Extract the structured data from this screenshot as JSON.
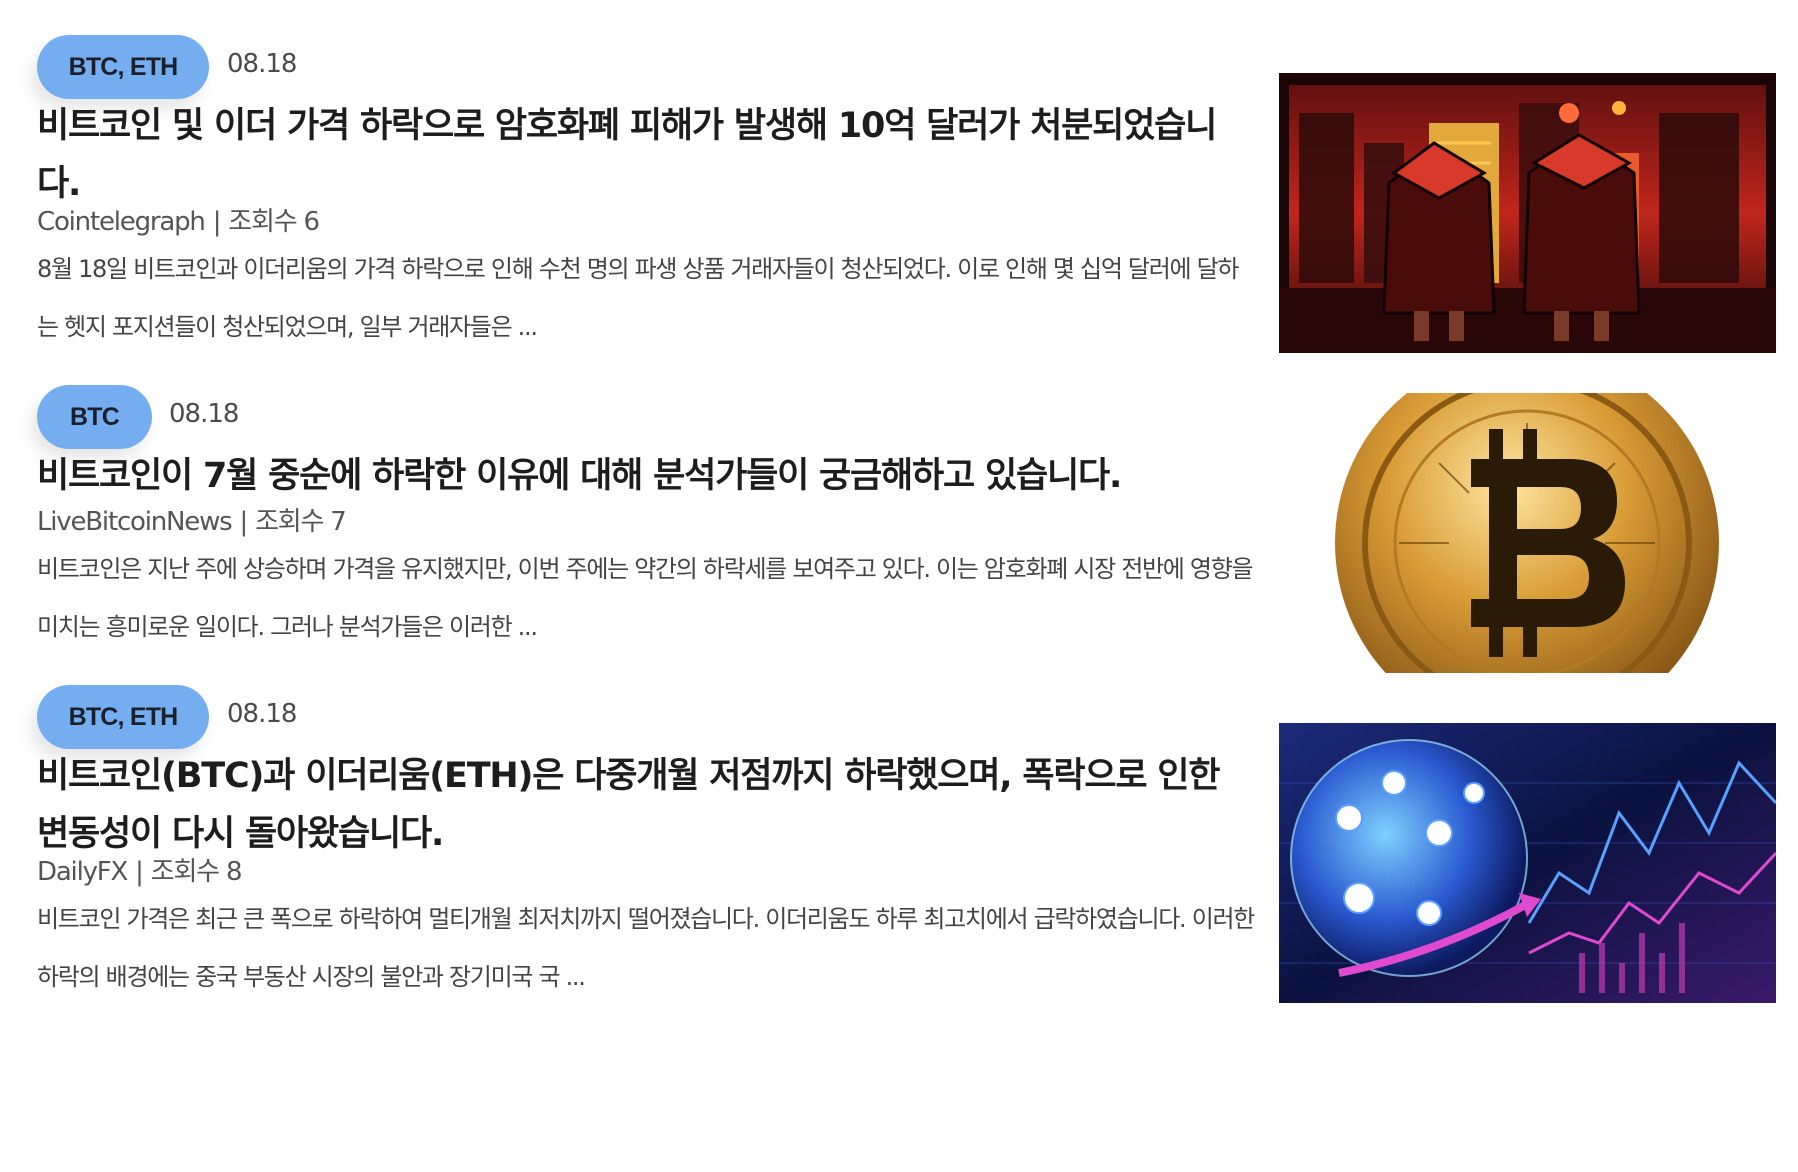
{
  "articles": [
    {
      "tag": "BTC, ETH",
      "date": "08.18",
      "title": "비트코인 및 이더 가격 하락으로 암호화폐 피해가 발생해 10억 달러가 처분되었습니다.",
      "source": "Cointelegraph",
      "views": "조회수 6",
      "summary": "8월 18일 비트코인과 이더리움의 가격 하락으로 인해 수천 명의 파생 상품 거래자들이 청산되었다. 이로 인해 몇 십억 달러에 달하는 헷지 포지션들이 청산되었으며, 일부 거래자들은 ...",
      "thumbnail": "crypto-bears-red-city-illustration"
    },
    {
      "tag": "BTC",
      "date": "08.18",
      "title": "비트코인이 7월 중순에 하락한 이유에 대해 분석가들이 궁금해하고 있습니다.",
      "source": "LiveBitcoinNews",
      "views": "조회수 7",
      "summary": "비트코인은 지난 주에 상승하며 가격을 유지했지만, 이번 주에는 약간의 하락세를 보여주고 있다. 이는 암호화폐 시장 전반에 영향을 미치는 흥미로운 일이다. 그러나 분석가들은 이러한 ...",
      "thumbnail": "gold-bitcoin-coin"
    },
    {
      "tag": "BTC, ETH",
      "date": "08.18",
      "title": "비트코인(BTC)과 이더리움(ETH)은 다중개월 저점까지 하락했으며, 폭락으로 인한 변동성이 다시 돌아왔습니다.",
      "source": "DailyFX",
      "views": "조회수 8",
      "summary": "비트코인 가격은 최근 큰 폭으로 하락하여 멀티개월 최저치까지 떨어졌습니다. 이더리움도 하루 최고치에서 급락하였습니다. 이러한 하락의 배경에는 중국 부동산 시장의 불안과 장기미국 국 ...",
      "thumbnail": "crypto-globe-chart"
    }
  ],
  "colors": {
    "tag_background": "#75aef0",
    "title_text": "#1d1d1d",
    "body_text": "#444444"
  }
}
